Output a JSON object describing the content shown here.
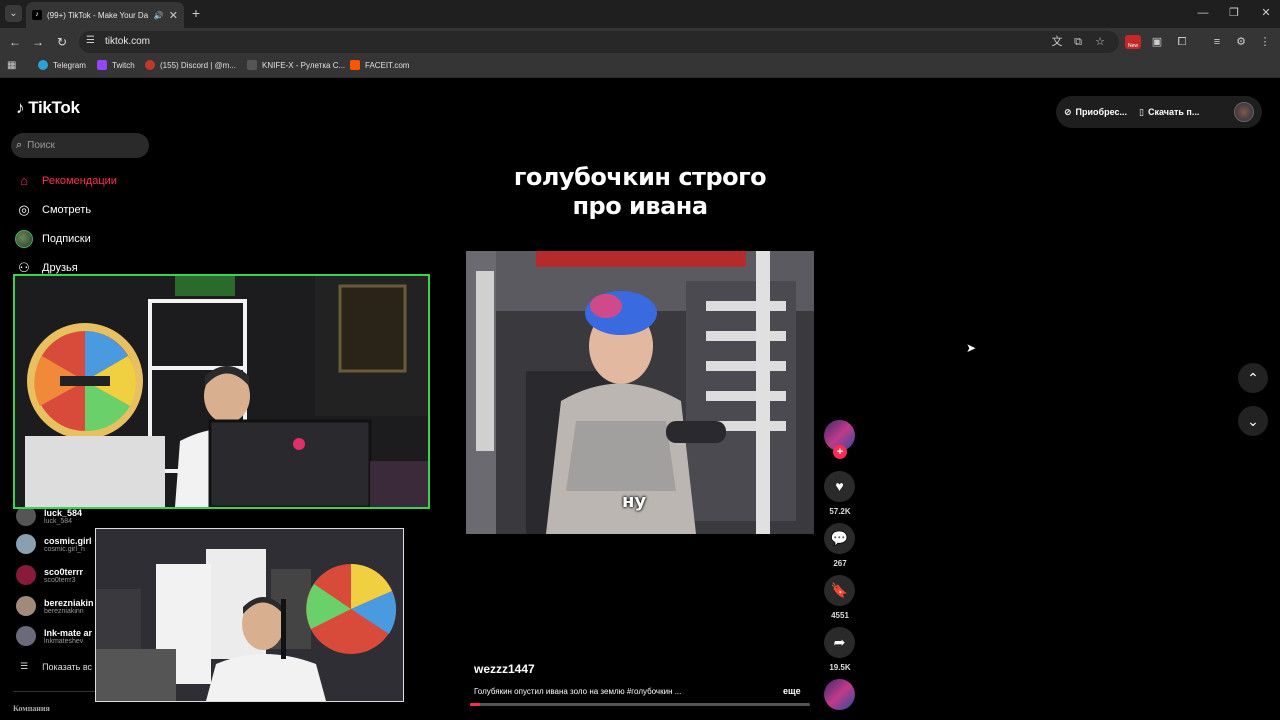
{
  "browser": {
    "tab_title": "(99+) TikTok - Make Your Da",
    "url": "tiktok.com",
    "bookmarks": [
      "Telegram",
      "Twitch",
      "(155) Discord | @m...",
      "KNIFE-X - Рулетка С...",
      "FACEIT.com"
    ],
    "ext_badge": "New"
  },
  "tiktok": {
    "logo": "TikTok",
    "search_placeholder": "Поиск",
    "nav": [
      "Рекомендации",
      "Смотреть",
      "Подписки",
      "Друзья"
    ],
    "following": [
      {
        "name": "luck_584",
        "handle": "luck_584"
      },
      {
        "name": "cosmic.girl",
        "handle": "cosmic.girl_n"
      },
      {
        "name": "sco0terrr",
        "handle": "sco0terrr3"
      },
      {
        "name": "berezniakin",
        "handle": "berezniakinn"
      },
      {
        "name": "lnk-mate ar",
        "handle": "lnkmateshev"
      }
    ],
    "show_all": "Показать вс",
    "company": "Компания",
    "top_buttons": [
      "Приобрес...",
      "Скачать п..."
    ],
    "headline_line1": "голубочкин строго",
    "headline_line2": "про ивана",
    "subtitle": "ну",
    "author": "wezzz1447",
    "description": "Голубякин опустил ивана золо на землю  #голубочкин ...",
    "more": "еще",
    "likes": "57.2K",
    "comments": "267",
    "saves": "4551",
    "shares": "19.5K",
    "progress": 0.03
  },
  "colors": {
    "accent": "#fe2c55",
    "cam_border": "#39d353"
  }
}
